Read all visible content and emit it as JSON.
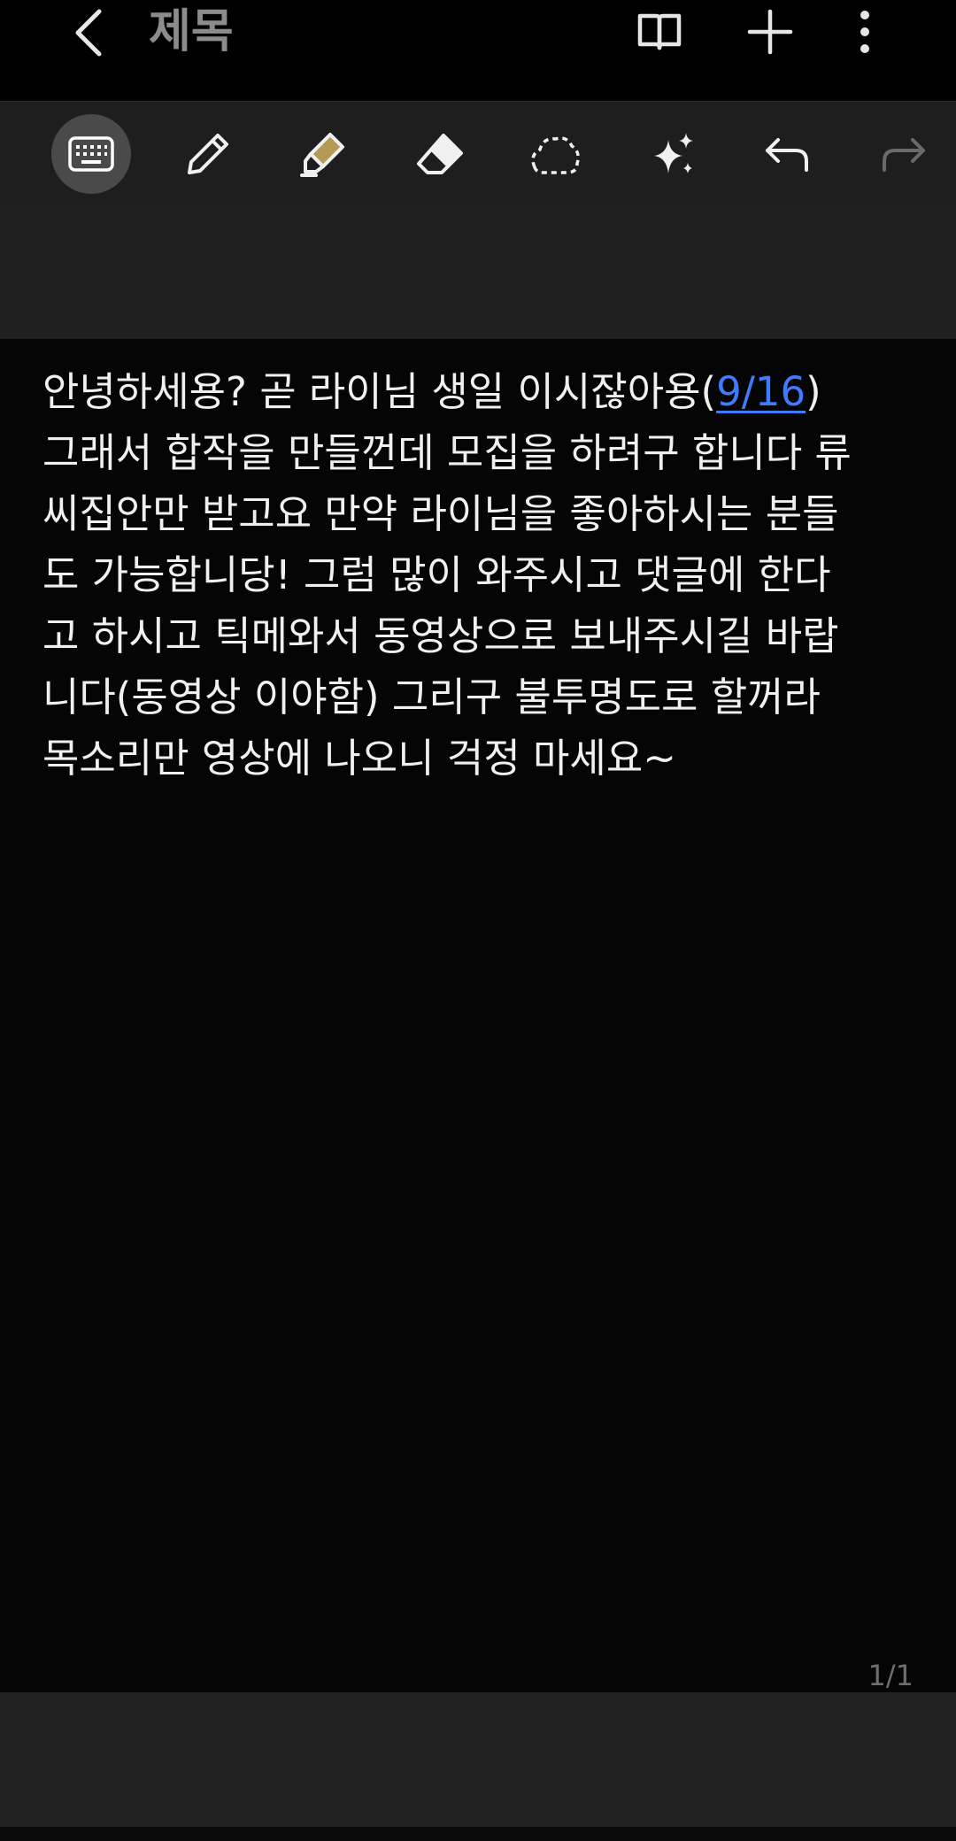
{
  "header": {
    "title": "제목",
    "back_icon": "chevron-left-icon",
    "actions": [
      "book-view-icon",
      "add-icon",
      "more-vert-icon"
    ]
  },
  "toolbar": {
    "tools": [
      "keyboard-icon",
      "pen-icon",
      "highlighter-icon",
      "eraser-icon",
      "lasso-select-icon",
      "ai-assist-icon",
      "undo-icon",
      "redo-icon"
    ],
    "active_tool": "keyboard-icon",
    "highlighter_color": "#b49a55"
  },
  "note": {
    "line1_a": "안녕하세용? 곧 라이님 생일 이시잖아용(",
    "line1_link": "9/16",
    "line1_b": ")",
    "line2": "그래서 합작을 만들껀데 모집을 하려구 합니다 류",
    "line3": "씨집안만 받고요 만약 라이님을 좋아하시는 분들",
    "line4": "도 가능합니당! 그럼 많이 와주시고 댓글에 한다",
    "line5": "고 하시고 틱메와서 동영상으로 보내주시길 바랍",
    "line6": "니다(동영상 이야함) 그리구 불투명도로 할꺼라",
    "line7": "목소리만 영상에 나오니 걱정 마세요~",
    "link_color": "#3f7bff"
  },
  "footer": {
    "page_indicator": "1/1"
  }
}
